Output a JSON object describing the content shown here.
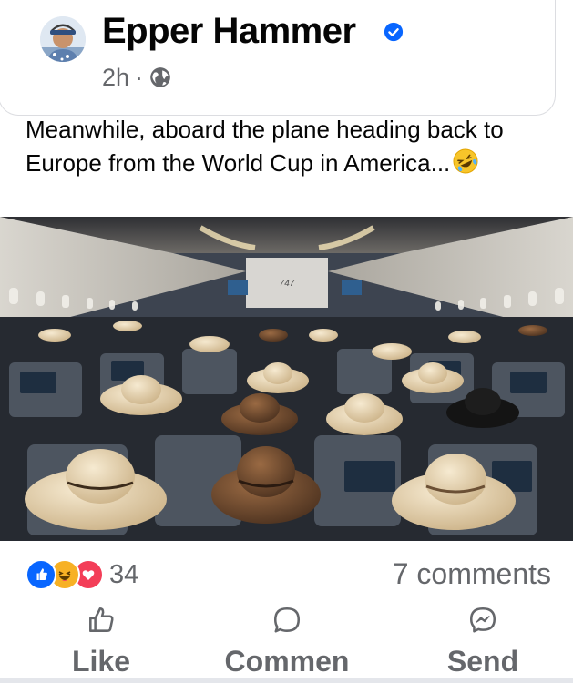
{
  "post": {
    "author": "Epper Hammer",
    "time": "2h",
    "separator": "·",
    "text": "Meanwhile, aboard the plane heading back to Europe from the World Cup in America...",
    "photo_label": "747"
  },
  "stats": {
    "reaction_count": "34",
    "comments": "7 comments"
  },
  "actions": {
    "like": "Like",
    "comment": "Commen",
    "send": "Send"
  },
  "colors": {
    "text": "#050505",
    "secondary": "#65676b",
    "verified": "#0866ff",
    "like": "#0866ff",
    "love": "#f33e58",
    "haha": "#f7b125"
  },
  "icons": [
    "verified-badge-icon",
    "globe-icon",
    "rofl-emoji-icon",
    "like-reaction-icon",
    "haha-reaction-icon",
    "love-reaction-icon",
    "thumbs-up-icon",
    "comment-bubble-icon",
    "messenger-icon"
  ]
}
